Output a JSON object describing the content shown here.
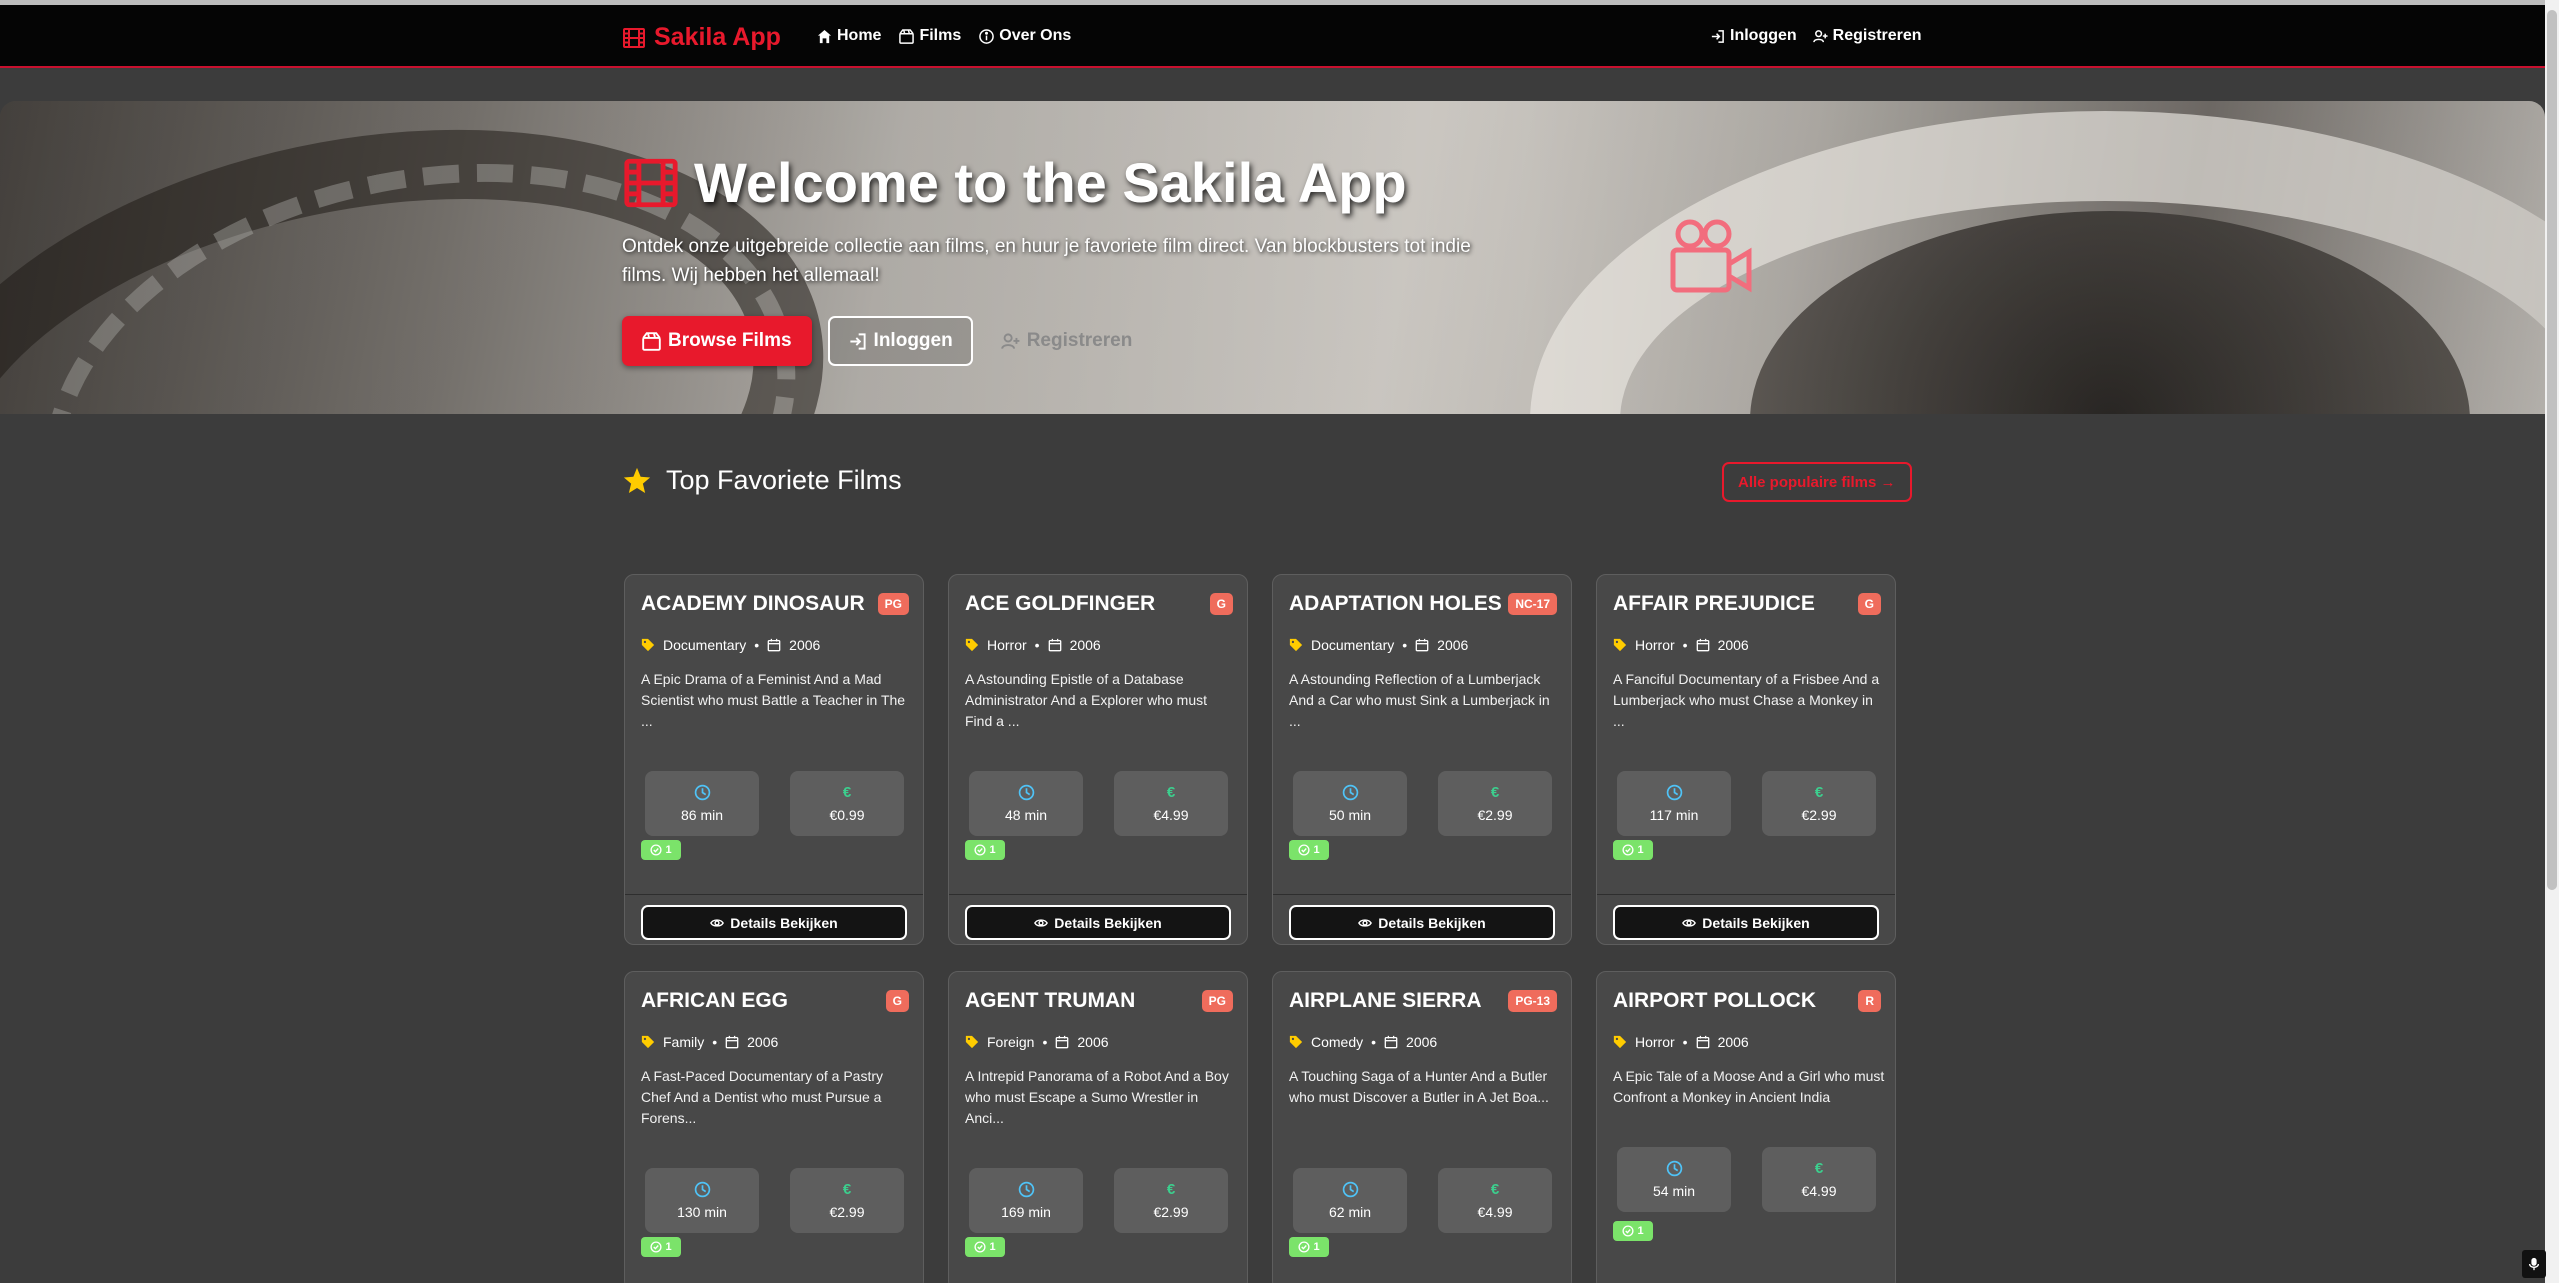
{
  "nav": {
    "brand": "Sakila App",
    "links": [
      "Home",
      "Films",
      "Over Ons"
    ],
    "login": "Inloggen",
    "register": "Registreren"
  },
  "hero": {
    "title": "Welcome to the Sakila App",
    "text": "Ontdek onze uitgebreide collectie aan films, en huur je favoriete film direct. Van blockbusters tot indie films. Wij hebben het allemaal!",
    "browse": "Browse Films",
    "login": "Inloggen",
    "register": "Registreren"
  },
  "section": {
    "title": "Top Favoriete Films",
    "all_popular": "Alle populaire films →"
  },
  "colors": {
    "accent": "#e8192c",
    "badge": "#ef6c5c",
    "available": "#7be36a",
    "price": "#3ccf8e",
    "duration": "#4fc3f7"
  },
  "films": [
    {
      "title": "ACADEMY DINOSAUR",
      "rating": "PG",
      "category": "Documentary",
      "year": "2006",
      "description": "A Epic Drama of a Feminist And a Mad Scientist who must Battle a Teacher in The ...",
      "length": "86 min",
      "price": "€0.99",
      "available": "1",
      "details": "Details Bekijken"
    },
    {
      "title": "ACE GOLDFINGER",
      "rating": "G",
      "category": "Horror",
      "year": "2006",
      "description": "A Astounding Epistle of a Database Administrator And a Explorer who must Find a ...",
      "length": "48 min",
      "price": "€4.99",
      "available": "1",
      "details": "Details Bekijken"
    },
    {
      "title": "ADAPTATION HOLES",
      "rating": "NC-17",
      "category": "Documentary",
      "year": "2006",
      "description": "A Astounding Reflection of a Lumberjack And a Car who must Sink a Lumberjack in ...",
      "length": "50 min",
      "price": "€2.99",
      "available": "1",
      "details": "Details Bekijken"
    },
    {
      "title": "AFFAIR PREJUDICE",
      "rating": "G",
      "category": "Horror",
      "year": "2006",
      "description": "A Fanciful Documentary of a Frisbee And a Lumberjack who must Chase a Monkey in ...",
      "length": "117 min",
      "price": "€2.99",
      "available": "1",
      "details": "Details Bekijken"
    },
    {
      "title": "AFRICAN EGG",
      "rating": "G",
      "category": "Family",
      "year": "2006",
      "description": "A Fast-Paced Documentary of a Pastry Chef And a Dentist who must Pursue a Forens...",
      "length": "130 min",
      "price": "€2.99",
      "available": "1"
    },
    {
      "title": "AGENT TRUMAN",
      "rating": "PG",
      "category": "Foreign",
      "year": "2006",
      "description": "A Intrepid Panorama of a Robot And a Boy who must Escape a Sumo Wrestler in Anci...",
      "length": "169 min",
      "price": "€2.99",
      "available": "1"
    },
    {
      "title": "AIRPLANE SIERRA",
      "rating": "PG-13",
      "category": "Comedy",
      "year": "2006",
      "description": "A Touching Saga of a Hunter And a Butler who must Discover a Butler in A Jet Boa...",
      "length": "62 min",
      "price": "€4.99",
      "available": "1"
    },
    {
      "title": "AIRPORT POLLOCK",
      "rating": "R",
      "category": "Horror",
      "year": "2006",
      "description": "A Epic Tale of a Moose And a Girl who must Confront a Monkey in Ancient India",
      "length": "54 min",
      "price": "€4.99",
      "available": "1"
    }
  ]
}
